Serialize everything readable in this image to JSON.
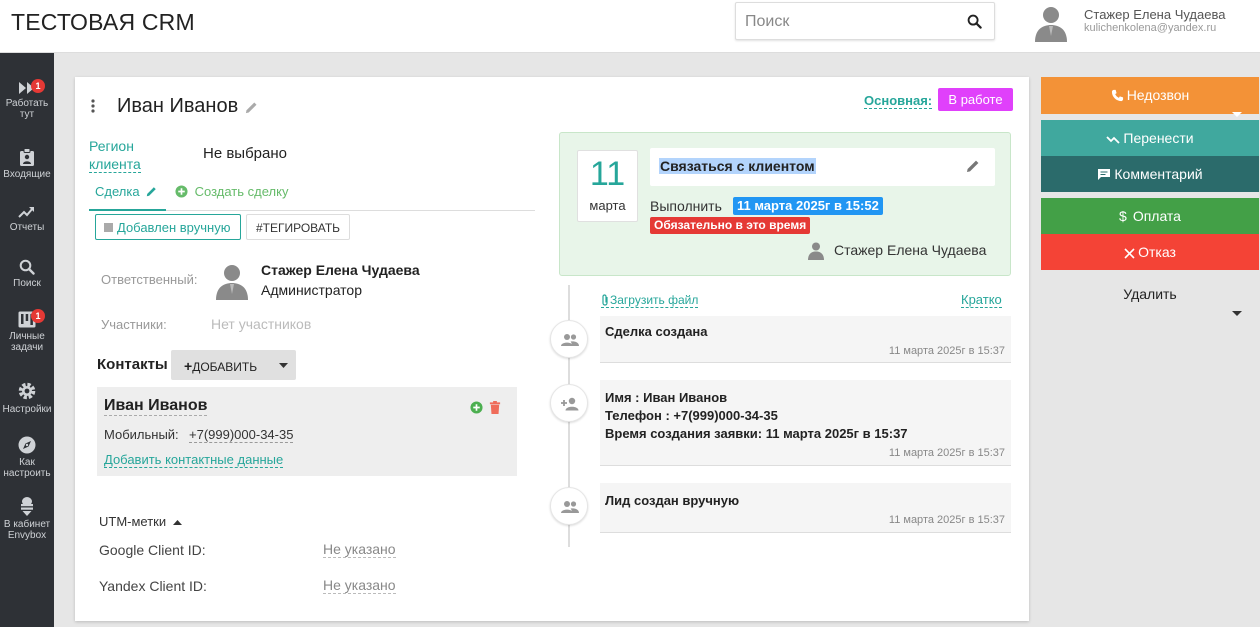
{
  "app": {
    "logo": "ТЕСТОВАЯ CRM"
  },
  "search": {
    "placeholder": "Поиск"
  },
  "user": {
    "name": "Стажер Елена Чудаева",
    "email": "kulichenkolena@yandex.ru"
  },
  "sidebar": {
    "items": [
      {
        "label1": "Работать",
        "label2": "тут",
        "badge": "1",
        "icon": "fast-forward-icon"
      },
      {
        "label1": "Входящие",
        "label2": "",
        "icon": "clipboard-icon"
      },
      {
        "label1": "Отчеты",
        "label2": "",
        "icon": "trending-up-icon"
      },
      {
        "label1": "Поиск",
        "label2": "",
        "icon": "search-icon"
      },
      {
        "label1": "Личные",
        "label2": "задачи",
        "badge": "1",
        "icon": "kanban-icon"
      },
      {
        "label1": "Настройки",
        "label2": "",
        "icon": "gear-icon"
      },
      {
        "label1": "Как",
        "label2": "настроить",
        "icon": "compass-icon"
      },
      {
        "label1": "В кабинет",
        "label2": "Envybox",
        "icon": "ice-cream-icon"
      }
    ]
  },
  "deal": {
    "title": "Иван Иванов",
    "region_label1": "Регион",
    "region_label2": "клиента",
    "region_value": "Не выбрано",
    "tab_deal": "Сделка",
    "tab_create": "Создать сделку",
    "btn_manual": "Добавлен вручную",
    "btn_tag": "#ТЕГИРОВАТЬ",
    "responsible_label": "Ответственный:",
    "responsible_name": "Стажер Елена Чудаева",
    "responsible_role": "Администратор",
    "participants_label": "Участники:",
    "participants_value": "Нет участников",
    "contacts_label": "Контакты",
    "add_label": "ДОБАВИТЬ",
    "contact": {
      "name": "Иван Иванов",
      "mobile_label": "Мобильный:",
      "mobile_value": "+7(999)000-34-35",
      "add_contact": "Добавить контактные данные"
    },
    "utm_label": "UTM-метки",
    "google_label": "Google Client ID:",
    "google_value": "Не указано",
    "yandex_label": "Yandex Client ID:",
    "yandex_value": "Не указано"
  },
  "status": {
    "main_label": "Основная:",
    "badge": "В работе",
    "badge_color": "#e040fb"
  },
  "task": {
    "day": "11",
    "month": "марта",
    "title": "Связаться с клиентом",
    "do_label": "Выполнить",
    "do_date": "11 марта 2025г в 15:52",
    "must": "Обязательно в это время",
    "user": "Стажер Елена Чудаева"
  },
  "timeline": {
    "upload": "Загрузить файл",
    "brief": "Кратко",
    "events": [
      {
        "lines": [
          "Сделка создана"
        ],
        "time": "11 марта 2025г в 15:37",
        "icon": "people-icon"
      },
      {
        "lines": [
          "Имя : Иван Иванов",
          "Телефон : +7(999)000-34-35",
          "Время создания заявки: 11 марта 2025г в 15:37"
        ],
        "time": "11 марта 2025г в 15:37",
        "icon": "person-add-icon"
      },
      {
        "lines": [
          "Лид создан вручную"
        ],
        "time": "11 марта 2025г в 15:37",
        "icon": "people-icon"
      }
    ]
  },
  "actions": {
    "no_answer": "Недозвон",
    "reschedule": "Перенести",
    "comment": "Комментарий",
    "payment": "Оплата",
    "refuse": "Отказ",
    "delete": "Удалить",
    "colors": {
      "orange": "#f39237",
      "teal": "#40a89e",
      "dark_teal": "#2b6b6b",
      "green": "#43a047",
      "red": "#f44336",
      "accent": "#26a69a"
    }
  }
}
